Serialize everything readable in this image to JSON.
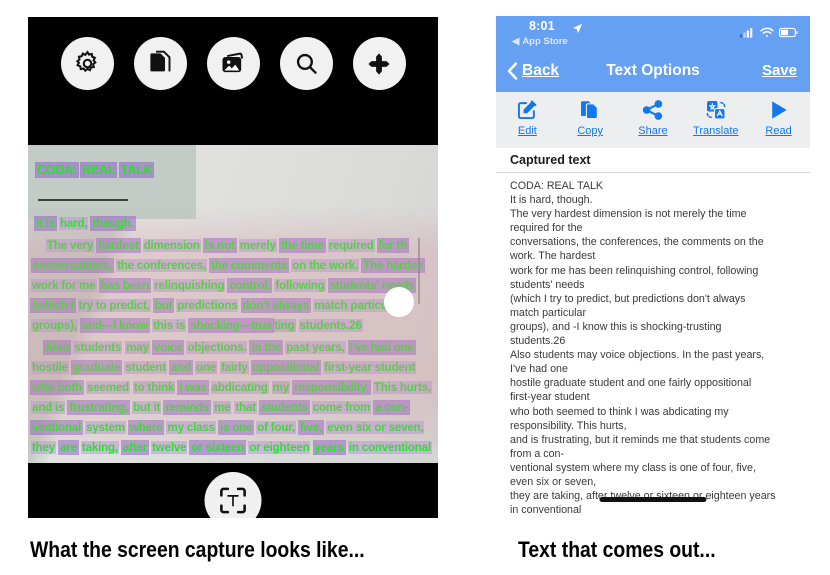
{
  "left_capture": {
    "caption": "What the screen capture looks like...",
    "toolbar_icons": [
      {
        "name": "settings-gear-icon",
        "label": "Settings"
      },
      {
        "name": "documents-icon",
        "label": "Documents"
      },
      {
        "name": "photo-library-icon",
        "label": "Photos"
      },
      {
        "name": "search-icon",
        "label": "Search"
      },
      {
        "name": "move-resize-icon",
        "label": "Move"
      }
    ],
    "shutter_button": {
      "name": "capture-text-button",
      "label": "T"
    },
    "ocr_overlay_lines": [
      "CODA: REAL TALK",
      "It is hard, though.",
      "The very hardest dimension is not merely the time required for th",
      "conversations, the conferences, the comments on the work. The hardes",
      "work for me has been relinquishing control, following students' needs",
      "(which I try to predict, but predictions don't always match particula",
      "groups), and—I know this is shocking—trusting students.26",
      "Also students may voice objections. In the past years, I've had one",
      "hostile graduate student and one fairly oppositional first-year student",
      "who both seemed to think I was abdicating my responsibility. This hurts,",
      "and is frustrating, but it reminds me that students come from a con-",
      "ventional system where my class is one of four, five, even six or seven,",
      "they are taking, after twelve or sixteen or eighteen years in conventional"
    ]
  },
  "right_app": {
    "caption": "Text that comes out...",
    "status_bar": {
      "time": "8:01",
      "return_app": "App Store",
      "return_prefix": "◀"
    },
    "nav_bar": {
      "back_label": "Back",
      "title": "Text Options",
      "save_label": "Save"
    },
    "toolbar": [
      {
        "icon": "edit-icon",
        "label": "Edit"
      },
      {
        "icon": "copy-icon",
        "label": "Copy"
      },
      {
        "icon": "share-icon",
        "label": "Share"
      },
      {
        "icon": "translate-icon",
        "label": "Translate"
      },
      {
        "icon": "read-play-icon",
        "label": "Read"
      }
    ],
    "section_header": "Captured text",
    "captured_text_lines": [
      "CODA: REAL TALK",
      "It is hard, though.",
      "The very hardest dimension is not merely the time",
      "required for the",
      "conversations, the conferences, the comments on the",
      "work. The hardest",
      "work for me has been relinquishing control, following",
      "students' needs",
      "(which I try to predict, but predictions don't always",
      "match particular",
      "groups), and -I know this is shocking-trusting",
      "students.26",
      "Also students may voice objections. In the past years,",
      "I've had one",
      "hostile graduate student and one fairly oppositional",
      "first-year student",
      "who both seemed to think I was abdicating my",
      "responsibility. This hurts,",
      "and is frustrating, but it reminds me that students come",
      "from a con-",
      "ventional system where my class is one of four, five,",
      "even six or seven,",
      "they are taking, after twelve or sixteen or eighteen years",
      "in conventional"
    ]
  },
  "colors": {
    "ios_blue": "#66a0f2",
    "link_blue": "#1278f0",
    "toolbar_grey": "#eceef0",
    "ocr_text_green": "#1ee81e",
    "ocr_highlight_purple": "#965fd2",
    "camera_black": "#000000"
  }
}
